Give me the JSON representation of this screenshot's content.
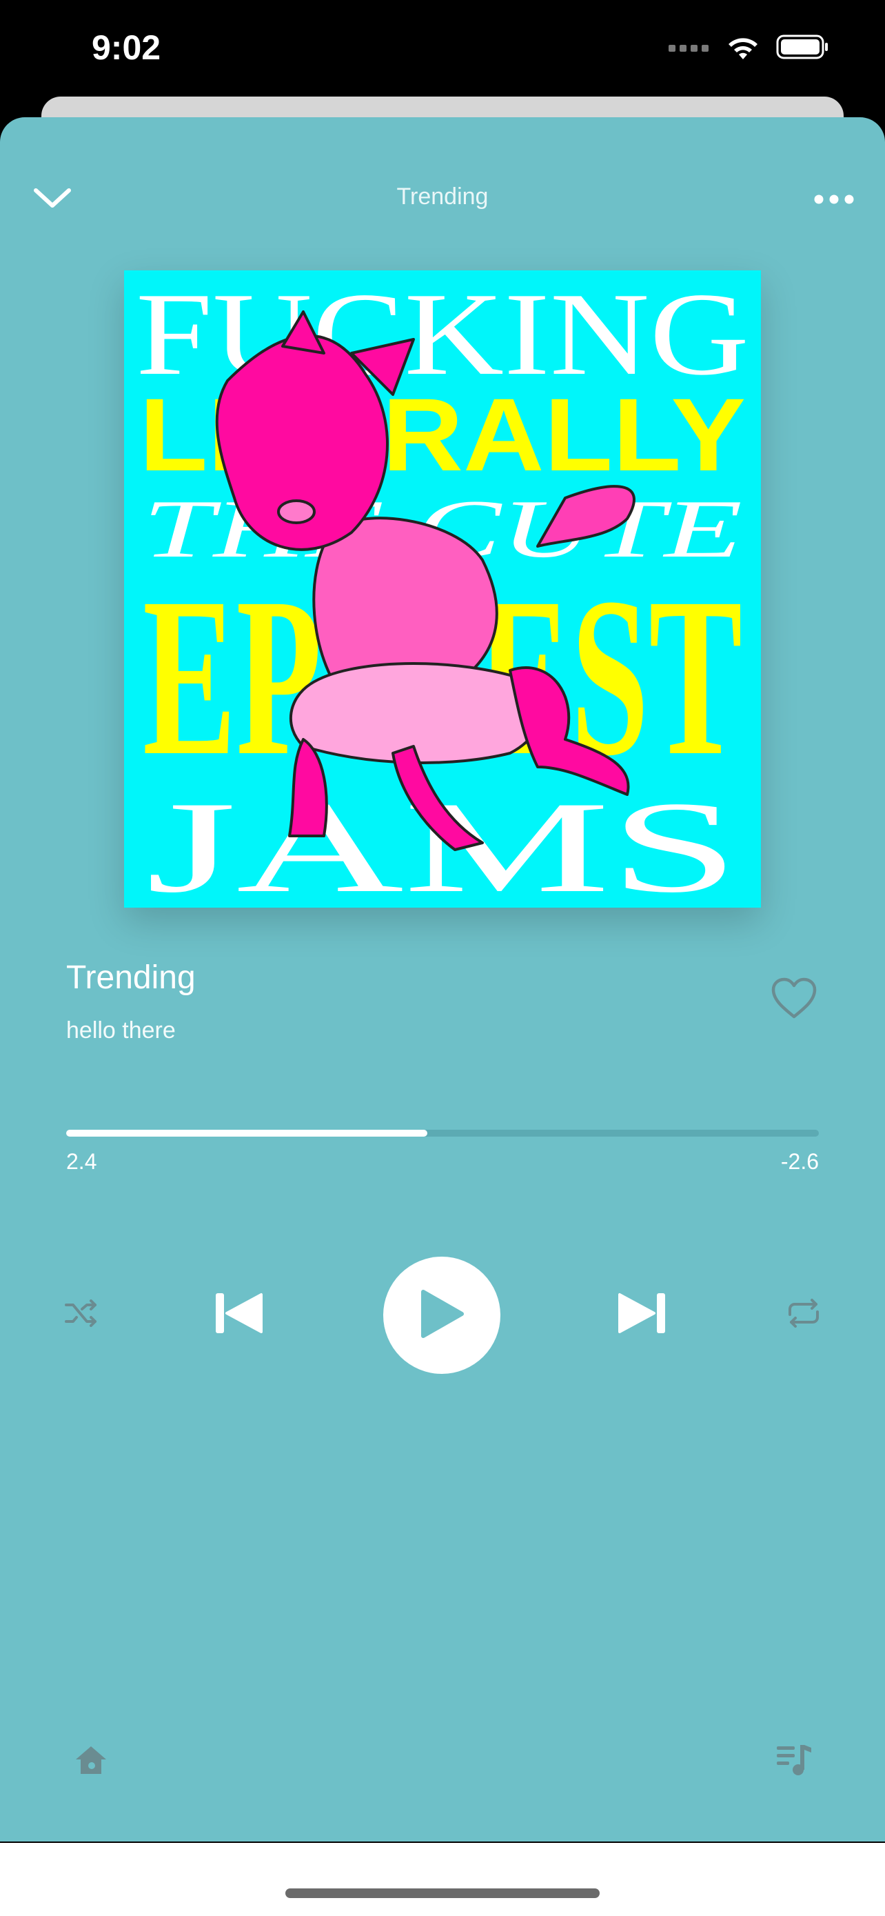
{
  "status_bar": {
    "time": "9:02"
  },
  "header": {
    "title": "Trending"
  },
  "artwork": {
    "lines": [
      "FUCKING",
      "LITERALLY",
      "THE CUTE",
      "EPICEST",
      "JAMS"
    ]
  },
  "track": {
    "title": "Trending",
    "artist": "hello there"
  },
  "progress": {
    "elapsed": "2.4",
    "remaining": "-2.6",
    "fraction": 0.48
  },
  "icons": {
    "collapse": "chevron-down-icon",
    "more": "more-icon",
    "favorite": "heart-icon",
    "shuffle": "shuffle-icon",
    "previous": "skip-previous-icon",
    "play": "play-icon",
    "next": "skip-next-icon",
    "repeat": "repeat-icon",
    "home": "home-icon",
    "queue": "queue-music-icon"
  },
  "colors": {
    "background": "#6ec0c8",
    "artwork_bg": "#00f6fa",
    "accent_pink": "#ff00a0",
    "accent_yellow": "#ffff00"
  }
}
